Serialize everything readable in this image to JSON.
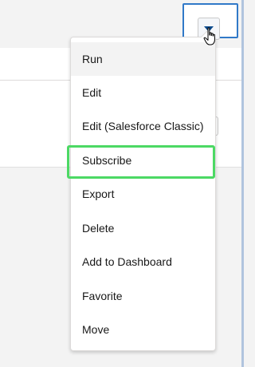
{
  "menu": {
    "items": [
      {
        "label": "Run"
      },
      {
        "label": "Edit"
      },
      {
        "label": "Edit (Salesforce Classic)"
      },
      {
        "label": "Subscribe"
      },
      {
        "label": "Export"
      },
      {
        "label": "Delete"
      },
      {
        "label": "Add to Dashboard"
      },
      {
        "label": "Favorite"
      },
      {
        "label": "Move"
      }
    ],
    "hovered_item": "Run",
    "highlighted_item": "Subscribe"
  },
  "menu_button": {
    "icon": "chevron-down-icon"
  },
  "colors": {
    "menu_button_border": "#3079c8",
    "highlight_border": "#4cd964",
    "caret": "#0a4a8c",
    "hover_bg": "#f3f3f3"
  }
}
